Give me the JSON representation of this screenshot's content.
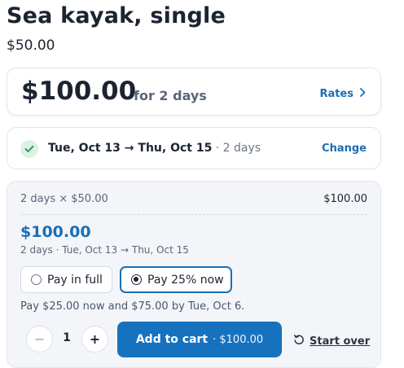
{
  "product": {
    "title": "Sea kayak, single",
    "base_price": "$50.00"
  },
  "total_card": {
    "amount": "$100.00",
    "for_text": "for 2 days",
    "rates_label": "Rates"
  },
  "dates": {
    "range": "Tue, Oct 13 → Thu, Oct 15",
    "duration": " · 2 days",
    "change_label": "Change"
  },
  "summary": {
    "line_label": "2 days × $50.00",
    "line_value": "$100.00",
    "total": "$100.00",
    "sub": "2 days · Tue, Oct 13 → Thu, Oct 15",
    "pay_options": [
      {
        "label": "Pay in full",
        "selected": false
      },
      {
        "label": "Pay 25% now",
        "selected": true
      }
    ],
    "pay_note": "Pay $25.00 now and $75.00 by Tue, Oct 6.",
    "quantity": "1",
    "minus_symbol": "−",
    "plus_symbol": "+",
    "add_to_cart_label": "Add to cart",
    "add_to_cart_price": "· $100.00",
    "start_over_label": "Start over"
  },
  "colors": {
    "accent": "#1a6fb5",
    "button": "#1672bf",
    "success_bg": "#dbf1e1",
    "success": "#2f8a4c"
  },
  "icons": [
    "check-icon",
    "chevron-right-icon",
    "restart-icon"
  ]
}
